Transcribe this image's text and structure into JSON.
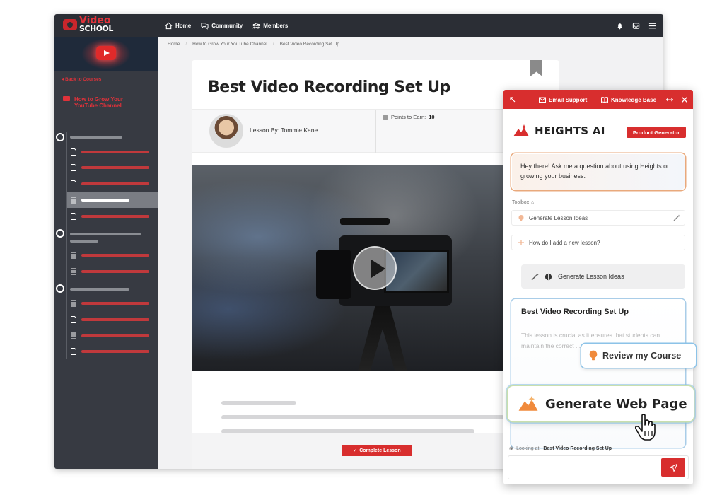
{
  "brand": {
    "logo_line1": "Video",
    "logo_line2": "SCHOOL"
  },
  "nav": [
    {
      "label": "Home",
      "icon": "home-icon"
    },
    {
      "label": "Community",
      "icon": "chat-icon"
    },
    {
      "label": "Members",
      "icon": "members-icon"
    }
  ],
  "top_icons": [
    "bell-icon",
    "inbox-icon",
    "menu-icon"
  ],
  "sidebar": {
    "back_label": "Back to Courses",
    "course_title": "How to Grow Your YouTube Channel"
  },
  "breadcrumb": [
    "Home",
    "How to Grow Your YouTube Channel",
    "Best Video Recording Set Up"
  ],
  "lesson": {
    "title": "Best Video Recording Set Up",
    "author_label": "Lesson By: Tommie Kane",
    "points_label": "Points to Earn:",
    "points_value": "10",
    "complete_label": "Complete Lesson"
  },
  "panel": {
    "email_support": "Email Support",
    "knowledge_base": "Knowledge Base",
    "brand_name": "HEIGHTS AI",
    "badge": "Product Generator",
    "greeting": "Hey there! Ask me a question about using Heights or growing your business.",
    "toolbox_label": "Toolbox",
    "tool_1": "Generate Lesson Ideas",
    "tool_2": "How do I add a new lesson?",
    "generate_button": "Generate Lesson Ideas",
    "result_title": "Best Video Recording Set Up",
    "result_body": "This lesson is crucial as it ensures that students can maintain the correct ... their guitar. Proper",
    "looking_label": "Looking at:",
    "looking_value": "Best Video Recording Set Up"
  },
  "overlays": {
    "review": "Review my Course",
    "generate_web": "Generate Web Page"
  },
  "colors": {
    "accent": "#d82e2e",
    "sidebar": "#373a42",
    "topbar": "#2b2e35"
  }
}
